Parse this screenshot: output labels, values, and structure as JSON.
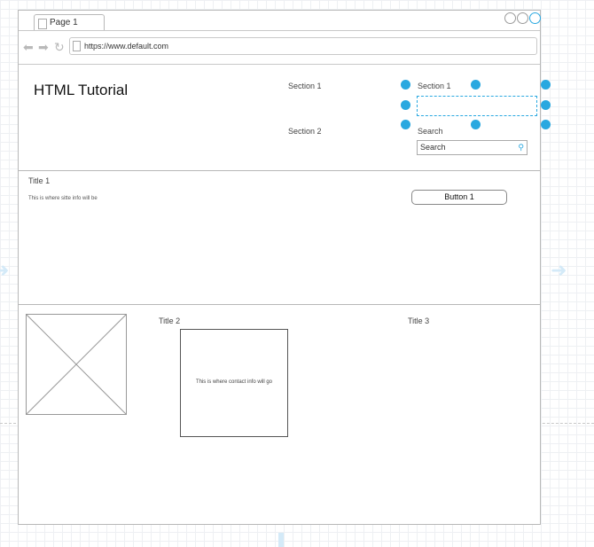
{
  "browser": {
    "tab_label": "Page 1",
    "url": "https://www.default.com",
    "icons": [
      "back-arrow-icon",
      "forward-arrow-icon",
      "reload-icon",
      "page-icon"
    ]
  },
  "header": {
    "title": "HTML Tutorial",
    "nav": {
      "section1": "Section 1",
      "section2": "Section 2"
    },
    "right": {
      "section1": "Section 1",
      "search_label": "Search",
      "search_placeholder": "Search"
    }
  },
  "main": {
    "title": "Title 1",
    "info": "This is where sitte info will be",
    "button_label": "Button 1"
  },
  "footer": {
    "title2": "Title 2",
    "title3": "Title 3",
    "contact": "This is where contact info will go"
  },
  "colors": {
    "accent": "#29a8e0",
    "border": "#b8b8b8"
  }
}
